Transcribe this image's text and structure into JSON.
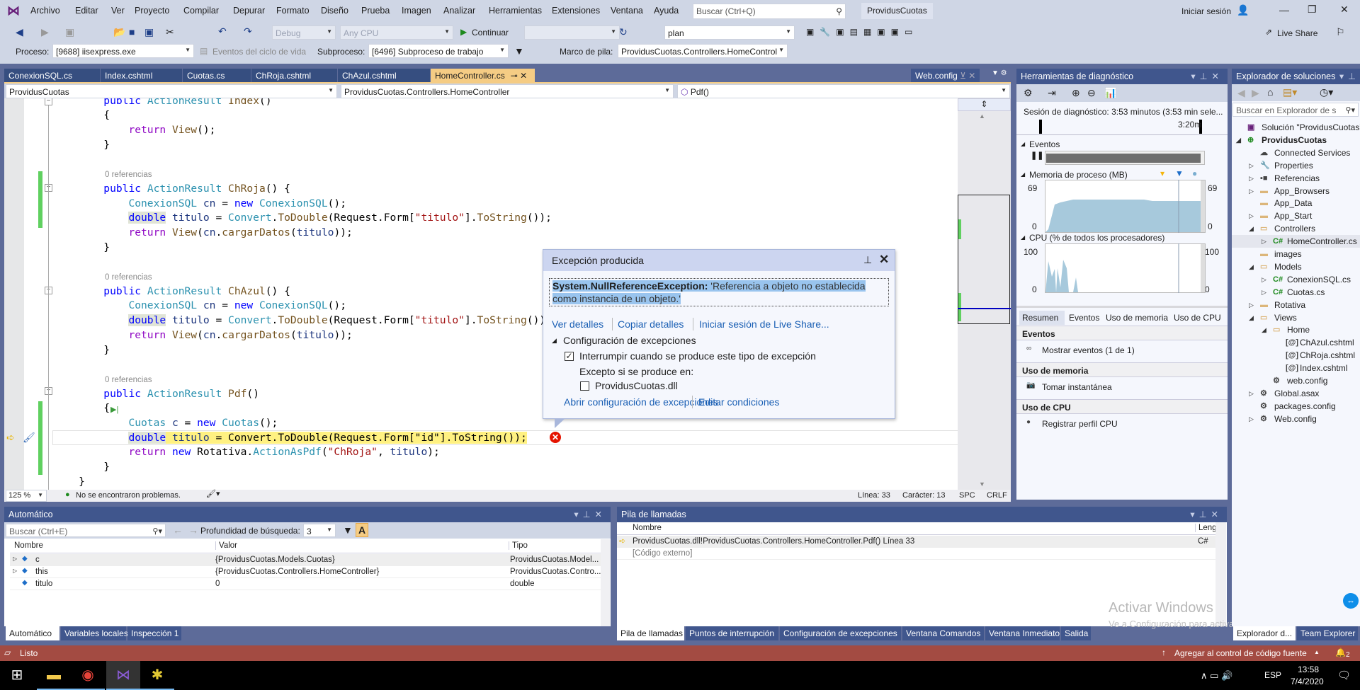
{
  "menu": {
    "items": [
      "Archivo",
      "Editar",
      "Ver",
      "Proyecto",
      "Compilar",
      "Depurar",
      "Formato",
      "Diseño",
      "Prueba",
      "Imagen",
      "Analizar",
      "Herramientas",
      "Extensiones",
      "Ventana",
      "Ayuda"
    ],
    "search_placeholder": "Buscar (Ctrl+Q)",
    "solution_badge": "ProvidusCuotas",
    "sign_in": "Iniciar sesión"
  },
  "toolbar": {
    "config": "Debug",
    "platform": "Any CPU",
    "continue": "Continuar",
    "find_value": "plan",
    "live_share": "Live Share"
  },
  "debug_location": {
    "process_label": "Proceso:",
    "process": "[9688] iisexpress.exe",
    "lifecycle": "Eventos del ciclo de vida",
    "thread_label": "Subproceso:",
    "thread": "[6496] Subproceso de trabajo",
    "stack_label": "Marco de pila:",
    "stack": "ProvidusCuotas.Controllers.HomeControl"
  },
  "doc_tabs": [
    {
      "label": "ConexionSQL.cs"
    },
    {
      "label": "Index.cshtml"
    },
    {
      "label": "Cuotas.cs"
    },
    {
      "label": "ChRoja.cshtml"
    },
    {
      "label": "ChAzul.cshtml"
    },
    {
      "label": "HomeController.cs",
      "active": true
    }
  ],
  "preview_tab": "Web.config",
  "navbar": {
    "project": "ProvidusCuotas",
    "type": "ProvidusCuotas.Controllers.HomeController",
    "member": "Pdf()"
  },
  "code_lines": [
    [
      [
        "        ",
        ""
      ],
      [
        "public",
        "kw"
      ],
      [
        " ",
        ""
      ],
      [
        "ActionResult",
        "ty"
      ],
      [
        " ",
        ""
      ],
      [
        "Index",
        "me"
      ],
      [
        "()",
        "pl"
      ]
    ],
    [
      [
        "        {",
        "pl"
      ]
    ],
    [
      [
        "            ",
        ""
      ],
      [
        "return",
        "ct"
      ],
      [
        " ",
        ""
      ],
      [
        "View",
        "me"
      ],
      [
        "();",
        "pl"
      ]
    ],
    [
      [
        "        }",
        "pl"
      ]
    ],
    [],
    {
      "lens": "0 referencias"
    },
    [
      [
        "        ",
        ""
      ],
      [
        "public",
        "kw"
      ],
      [
        " ",
        ""
      ],
      [
        "ActionResult",
        "ty"
      ],
      [
        " ",
        ""
      ],
      [
        "ChRoja",
        "me"
      ],
      [
        "() {",
        "pl"
      ]
    ],
    [
      [
        "            ",
        ""
      ],
      [
        "ConexionSQL",
        "ty"
      ],
      [
        " ",
        ""
      ],
      [
        "cn",
        "va"
      ],
      [
        " = ",
        "pl"
      ],
      [
        "new",
        "kw"
      ],
      [
        " ",
        ""
      ],
      [
        "ConexionSQL",
        "ty"
      ],
      [
        "();",
        "pl"
      ]
    ],
    [
      [
        "            ",
        ""
      ],
      [
        "double",
        "kw hl"
      ],
      [
        " ",
        ""
      ],
      [
        "titulo",
        "va"
      ],
      [
        " = ",
        "pl"
      ],
      [
        "Convert",
        "ty"
      ],
      [
        ".",
        "pl"
      ],
      [
        "ToDouble",
        "me"
      ],
      [
        "(Request.Form[",
        "pl"
      ],
      [
        "\"titulo\"",
        "st"
      ],
      [
        "].",
        "pl"
      ],
      [
        "ToString",
        "me"
      ],
      [
        "());",
        "pl"
      ]
    ],
    [
      [
        "            ",
        ""
      ],
      [
        "return",
        "ct"
      ],
      [
        " ",
        ""
      ],
      [
        "View",
        "me"
      ],
      [
        "(",
        "pl"
      ],
      [
        "cn",
        "va"
      ],
      [
        ".",
        "pl"
      ],
      [
        "cargarDatos",
        "me"
      ],
      [
        "(",
        "pl"
      ],
      [
        "titulo",
        "va"
      ],
      [
        "));",
        "pl"
      ]
    ],
    [
      [
        "        }",
        "pl"
      ]
    ],
    [],
    {
      "lens": "0 referencias"
    },
    [
      [
        "        ",
        ""
      ],
      [
        "public",
        "kw"
      ],
      [
        " ",
        ""
      ],
      [
        "ActionResult",
        "ty"
      ],
      [
        " ",
        ""
      ],
      [
        "ChAzul",
        "me"
      ],
      [
        "() {",
        "pl"
      ]
    ],
    [
      [
        "            ",
        ""
      ],
      [
        "ConexionSQL",
        "ty"
      ],
      [
        " ",
        ""
      ],
      [
        "cn",
        "va"
      ],
      [
        " = ",
        "pl"
      ],
      [
        "new",
        "kw"
      ],
      [
        " ",
        ""
      ],
      [
        "ConexionSQL",
        "ty"
      ],
      [
        "();",
        "pl"
      ]
    ],
    [
      [
        "            ",
        ""
      ],
      [
        "double",
        "kw hl"
      ],
      [
        " ",
        ""
      ],
      [
        "titulo",
        "va"
      ],
      [
        " = ",
        "pl"
      ],
      [
        "Convert",
        "ty"
      ],
      [
        ".",
        "pl"
      ],
      [
        "ToDouble",
        "me"
      ],
      [
        "(Request.Form[",
        "pl"
      ],
      [
        "\"titulo\"",
        "st"
      ],
      [
        "].",
        "pl"
      ],
      [
        "ToString",
        "me"
      ],
      [
        "());",
        "pl"
      ]
    ],
    [
      [
        "            ",
        ""
      ],
      [
        "return",
        "ct"
      ],
      [
        " ",
        ""
      ],
      [
        "View",
        "me"
      ],
      [
        "(",
        "pl"
      ],
      [
        "cn",
        "va"
      ],
      [
        ".",
        "pl"
      ],
      [
        "cargarDatos",
        "me"
      ],
      [
        "(",
        "pl"
      ],
      [
        "titulo",
        "va"
      ],
      [
        "));",
        "pl"
      ]
    ],
    [
      [
        "        }",
        "pl"
      ]
    ],
    [],
    {
      "lens": "0 referencias"
    },
    [
      [
        "        ",
        ""
      ],
      [
        "public",
        "kw"
      ],
      [
        " ",
        ""
      ],
      [
        "ActionResult",
        "ty"
      ],
      [
        " ",
        ""
      ],
      [
        "Pdf",
        "me"
      ],
      [
        "()",
        "pl"
      ]
    ],
    [
      [
        "        {",
        "pl"
      ]
    ],
    [
      [
        "            ",
        ""
      ],
      [
        "Cuotas",
        "ty"
      ],
      [
        " ",
        ""
      ],
      [
        "c",
        "va"
      ],
      [
        " = ",
        "pl"
      ],
      [
        "new",
        "kw"
      ],
      [
        " ",
        ""
      ],
      [
        "Cuotas",
        "ty"
      ],
      [
        "();",
        "pl"
      ]
    ],
    [
      [
        "            ",
        ""
      ],
      [
        "double",
        "kw hl"
      ],
      [
        " ",
        "cur"
      ],
      [
        "titulo",
        "va cur"
      ],
      [
        " = ",
        "pl cur"
      ],
      [
        "Convert",
        "pl cur"
      ],
      [
        ".",
        "pl cur"
      ],
      [
        "ToDouble",
        "pl cur"
      ],
      [
        "(Request.Form[",
        "pl cur"
      ],
      [
        "\"id\"",
        "pl cur"
      ],
      [
        "].",
        "pl cur"
      ],
      [
        "ToString",
        "pl cur"
      ],
      [
        "());",
        "pl cur"
      ]
    ],
    [
      [
        "            ",
        ""
      ],
      [
        "return",
        "ct"
      ],
      [
        " ",
        ""
      ],
      [
        "new",
        "kw"
      ],
      [
        " Rotativa.",
        "pl"
      ],
      [
        "ActionAsPdf",
        "ty"
      ],
      [
        "(",
        "pl"
      ],
      [
        "\"ChRoja\"",
        "st"
      ],
      [
        ", ",
        "pl"
      ],
      [
        "titulo",
        "va"
      ],
      [
        ");",
        "pl"
      ]
    ],
    [
      [
        "        }",
        "pl"
      ]
    ],
    [
      [
        "    }",
        "pl"
      ]
    ]
  ],
  "editor_status": {
    "zoom": "125 %",
    "problems": "No se encontraron problemas.",
    "line": "Línea: 33",
    "char": "Carácter: 13",
    "spc": "SPC",
    "crlf": "CRLF"
  },
  "exception": {
    "title": "Excepción producida",
    "type": "System.NullReferenceException:",
    "message": " 'Referencia a objeto no establecida como instancia de un objeto.'",
    "links": [
      "Ver detalles",
      "Copiar detalles",
      "Iniciar sesión de Live Share..."
    ],
    "settings_header": "Configuración de excepciones",
    "break_label": "Interrumpir cuando se produce este tipo de excepción",
    "break_checked": true,
    "except_label": "Excepto si se produce en:",
    "dll_label": "ProvidusCuotas.dll",
    "dll_checked": false,
    "bottom_links": [
      "Abrir configuración de excepciones",
      "Editar condiciones"
    ]
  },
  "autos": {
    "title": "Automático",
    "search_placeholder": "Buscar (Ctrl+E)",
    "depth_label": "Profundidad de búsqueda:",
    "depth": "3",
    "columns": [
      "Nombre",
      "Valor",
      "Tipo"
    ],
    "rows": [
      {
        "name": "c",
        "value": "{ProvidusCuotas.Models.Cuotas}",
        "type": "ProvidusCuotas.Model..."
      },
      {
        "name": "this",
        "value": "{ProvidusCuotas.Controllers.HomeController}",
        "type": "ProvidusCuotas.Contro..."
      },
      {
        "name": "titulo",
        "value": "0",
        "type": "double"
      }
    ],
    "tabs": [
      "Automático",
      "Variables locales",
      "Inspección 1"
    ]
  },
  "callstack": {
    "title": "Pila de llamadas",
    "columns": [
      "Nombre",
      "Leng"
    ],
    "rows": [
      {
        "name": "ProvidusCuotas.dll!ProvidusCuotas.Controllers.HomeController.Pdf() Línea 33",
        "lang": "C#"
      },
      {
        "name": "[Código externo]",
        "lang": ""
      }
    ],
    "tabs": [
      "Pila de llamadas",
      "Puntos de interrupción",
      "Configuración de excepciones",
      "Ventana Comandos",
      "Ventana Inmediato",
      "Salida"
    ],
    "watermark_title": "Activar Windows",
    "watermark_sub": "Ve a Configuración para activar Windows."
  },
  "diagnostics": {
    "title": "Herramientas de diagnóstico",
    "session": "Sesión de diagnóstico: 3:53 minutos (3:53 min sele...",
    "ruler_label": "3:20m",
    "events_label": "Eventos",
    "memory_label": "Memoria de proceso (MB)",
    "memory_max": "69",
    "memory_min": "0",
    "cpu_label": "CPU (% de todos los procesadores)",
    "cpu_max": "100",
    "cpu_min": "0",
    "tabs": [
      "Resumen",
      "Eventos",
      "Uso de memoria",
      "Uso de CPU"
    ],
    "sections": [
      {
        "header": "Eventos",
        "action": "Mostrar eventos (1 de 1)"
      },
      {
        "header": "Uso de memoria",
        "action": "Tomar instantánea"
      },
      {
        "header": "Uso de CPU",
        "action": "Registrar perfil CPU"
      }
    ]
  },
  "solution": {
    "title": "Explorador de soluciones",
    "search_placeholder": "Buscar en Explorador de s",
    "items": [
      {
        "label": "Solución \"ProvidusCuotas\"",
        "level": 0,
        "exp": "",
        "icon": "solution-icon"
      },
      {
        "label": "ProvidusCuotas",
        "level": 0,
        "exp": "open",
        "icon": "web-project-icon",
        "bold": true
      },
      {
        "label": "Connected Services",
        "level": 1,
        "exp": "",
        "icon": "cloud-icon"
      },
      {
        "label": "Properties",
        "level": 1,
        "exp": "closed",
        "icon": "wrench-icon"
      },
      {
        "label": "Referencias",
        "level": 1,
        "exp": "closed",
        "icon": "references-icon"
      },
      {
        "label": "App_Browsers",
        "level": 1,
        "exp": "closed",
        "icon": "folder-icon"
      },
      {
        "label": "App_Data",
        "level": 1,
        "exp": "",
        "icon": "folder-icon"
      },
      {
        "label": "App_Start",
        "level": 1,
        "exp": "closed",
        "icon": "folder-icon"
      },
      {
        "label": "Controllers",
        "level": 1,
        "exp": "open",
        "icon": "folder-open-icon"
      },
      {
        "label": "HomeController.cs",
        "level": 2,
        "exp": "closed",
        "icon": "csharp-file-icon",
        "selected": true
      },
      {
        "label": "images",
        "level": 1,
        "exp": "",
        "icon": "folder-icon"
      },
      {
        "label": "Models",
        "level": 1,
        "exp": "open",
        "icon": "folder-open-icon"
      },
      {
        "label": "ConexionSQL.cs",
        "level": 2,
        "exp": "closed",
        "icon": "csharp-file-icon"
      },
      {
        "label": "Cuotas.cs",
        "level": 2,
        "exp": "closed",
        "icon": "csharp-file-icon"
      },
      {
        "label": "Rotativa",
        "level": 1,
        "exp": "closed",
        "icon": "folder-icon"
      },
      {
        "label": "Views",
        "level": 1,
        "exp": "open",
        "icon": "folder-open-icon"
      },
      {
        "label": "Home",
        "level": 2,
        "exp": "open",
        "icon": "folder-open-icon"
      },
      {
        "label": "ChAzul.cshtml",
        "level": 3,
        "exp": "",
        "icon": "razor-file-icon"
      },
      {
        "label": "ChRoja.cshtml",
        "level": 3,
        "exp": "",
        "icon": "razor-file-icon"
      },
      {
        "label": "Index.cshtml",
        "level": 3,
        "exp": "",
        "icon": "razor-file-icon"
      },
      {
        "label": "web.config",
        "level": 2,
        "exp": "",
        "icon": "config-file-icon"
      },
      {
        "label": "Global.asax",
        "level": 1,
        "exp": "closed",
        "icon": "asax-file-icon"
      },
      {
        "label": "packages.config",
        "level": 1,
        "exp": "",
        "icon": "config-file-icon"
      },
      {
        "label": "Web.config",
        "level": 1,
        "exp": "closed",
        "icon": "config-file-icon"
      }
    ],
    "tabs": [
      "Explorador d...",
      "Team Explorer"
    ]
  },
  "statusbar": {
    "ready": "Listo",
    "source_control": "Agregar al control de código fuente",
    "notifications": "2"
  },
  "taskbar": {
    "lang": "ESP",
    "time": "13:58",
    "date": "7/4/2020"
  },
  "colors": {
    "accent": "#40568d",
    "active_tab": "#f5cc84",
    "status_debug": "#a34b42",
    "current_line": "#fff181",
    "error": "#e51400"
  }
}
